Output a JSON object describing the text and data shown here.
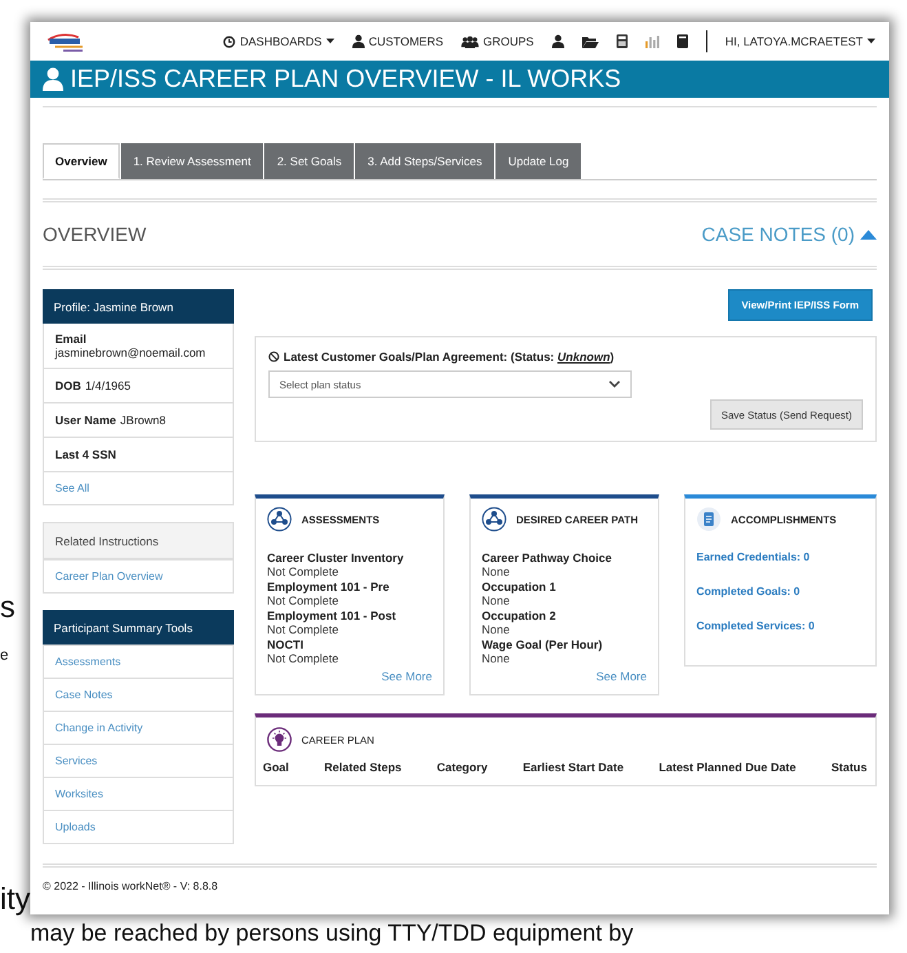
{
  "background_text": [
    {
      "text": "s",
      "kind": "large"
    },
    {
      "text": "e",
      "kind": "small"
    },
    {
      "text": "ity",
      "kind": "large"
    },
    {
      "text": "may be reached by persons using TTY/TDD equipment by",
      "kind": "large"
    }
  ],
  "nav": {
    "items": [
      {
        "label": "DASHBOARDS",
        "dropdown": true
      },
      {
        "label": "CUSTOMERS",
        "dropdown": false
      },
      {
        "label": "GROUPS",
        "dropdown": false
      }
    ],
    "user": {
      "label": "HI, LATOYA.MCRAETEST",
      "dropdown": true
    }
  },
  "page_title": "IEP/ISS CAREER PLAN OVERVIEW - IL WORKS",
  "tabs": [
    {
      "label": "Overview",
      "selected": true
    },
    {
      "label": "1. Review Assessment",
      "selected": false
    },
    {
      "label": "2. Set Goals",
      "selected": false
    },
    {
      "label": "3. Add Steps/Services",
      "selected": false
    },
    {
      "label": "Update Log",
      "selected": false
    }
  ],
  "section": {
    "title": "OVERVIEW",
    "case_notes": "CASE NOTES (0)",
    "expanded": true
  },
  "profile": {
    "title": "Profile: Jasmine Brown",
    "fields": [
      {
        "label": "Email",
        "value": "jasminebrown@noemail.com",
        "kind": "stacked"
      },
      {
        "label": "DOB",
        "value": "1/4/1965",
        "kind": "inline"
      },
      {
        "label": "User Name",
        "value": "JBrown8",
        "kind": "inline"
      },
      {
        "label": "Last 4 SSN",
        "kind": "inline"
      }
    ],
    "link": "See All"
  },
  "related": {
    "title": "Related Instructions",
    "items": [
      "Career Plan Overview"
    ]
  },
  "tools_panel": {
    "title": "Participant Summary Tools",
    "items": [
      "Assessments",
      "Case Notes",
      "Change in Activity",
      "Services",
      "Worksites",
      "Uploads"
    ]
  },
  "print_button": "View/Print IEP/ISS Form",
  "agreement": {
    "label": "Latest Customer Goals/Plan Agreement: (Status: ",
    "status": "Unknown",
    "suffix": ")",
    "select": {
      "placeholder": "Select plan status"
    },
    "save_button": "Save Status (Send Request)"
  },
  "cards": [
    {
      "title": "ASSESSMENTS",
      "color": "#1e4d8c",
      "kind": "list",
      "items": [
        {
          "label": "Career Cluster Inventory",
          "value": "Not Complete"
        },
        {
          "label": "Employment 101 - Pre",
          "value": "Not Complete"
        },
        {
          "label": "Employment 101 - Post",
          "value": "Not Complete"
        },
        {
          "label": "NOCTI",
          "value": "Not Complete"
        }
      ],
      "see_more": "See More"
    },
    {
      "title": "DESIRED CAREER PATH",
      "color": "#1e4d8c",
      "kind": "list",
      "items": [
        {
          "label": "Career Pathway Choice",
          "value": "None"
        },
        {
          "label": "Occupation 1",
          "value": "None"
        },
        {
          "label": "Occupation 2",
          "value": "None"
        },
        {
          "label": "Wage Goal (Per Hour)",
          "value": "None"
        }
      ],
      "see_more": "See More"
    },
    {
      "title": "ACCOMPLISHMENTS",
      "color": "#2b8ad8",
      "kind": "links",
      "items": [
        {
          "label": "Earned Credentials: 0"
        },
        {
          "label": "Completed Goals: 0"
        },
        {
          "label": "Completed Services: 0"
        }
      ]
    }
  ],
  "career_plan": {
    "title": "CAREER PLAN",
    "columns": [
      "Goal",
      "Related Steps",
      "Category",
      "Earliest Start Date",
      "Latest Planned Due Date",
      "Status"
    ]
  },
  "footer": "© 2022 - Illinois workNet® - V: 8.8.8"
}
